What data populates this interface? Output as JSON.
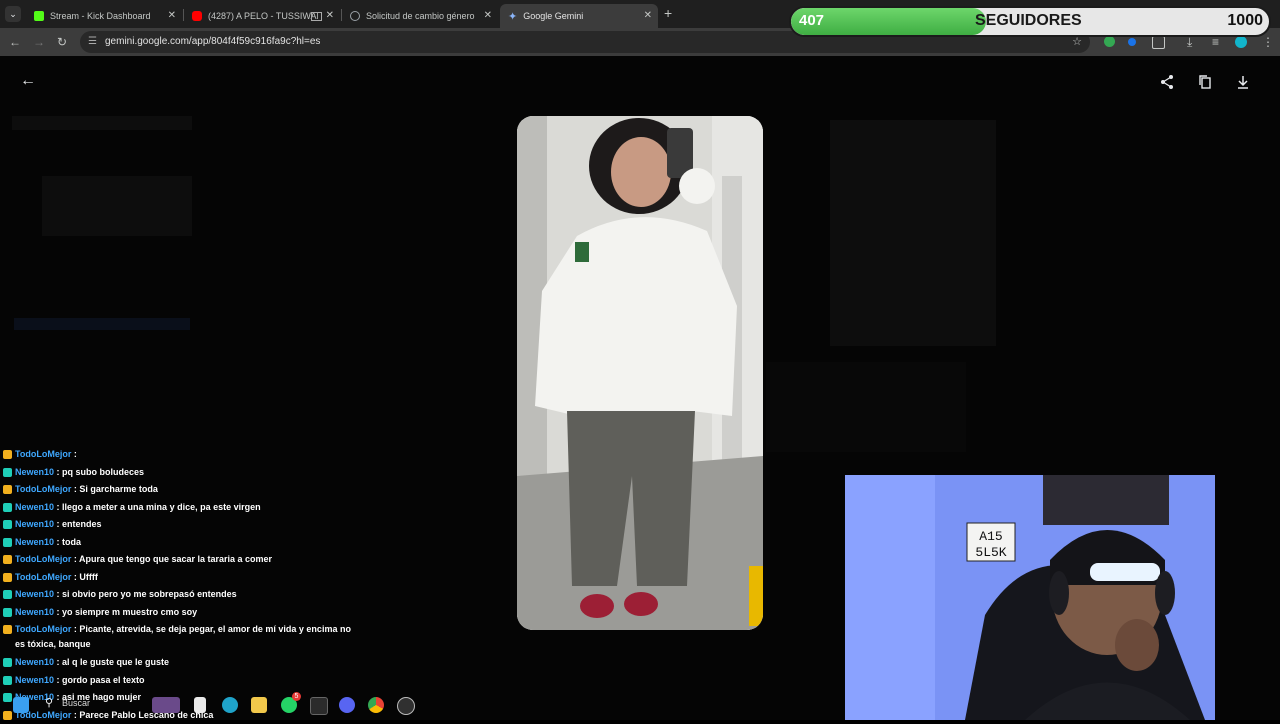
{
  "browser": {
    "tabs": [
      {
        "title": "Stream - Kick Dashboard",
        "icon": "kick-icon",
        "color": "#53fc18"
      },
      {
        "title": "(4287) A PELO - TUSSIWAR...",
        "icon": "youtube-icon",
        "color": "#ff0000"
      },
      {
        "title": "Solicitud de cambio género",
        "icon": "globe-icon",
        "color": "#9aa0a6"
      },
      {
        "title": "Google Gemini",
        "icon": "gemini-icon",
        "color": "#8ab4f8"
      }
    ],
    "active_tab": 3,
    "url": "gemini.google.com/app/804f4f59c916fa9c?hl=es"
  },
  "followers": {
    "current": "407",
    "label": "SEGUIDORES",
    "goal": "1000",
    "progress": 0.407,
    "color": "#4cbf4f"
  },
  "viewer": {
    "back_icon": "arrow-left-icon",
    "actions": [
      "share-icon",
      "copy-icon",
      "download-icon"
    ]
  },
  "chat": [
    {
      "user": "TodoLoMejor",
      "text": " : ",
      "badge": "#f2b01e"
    },
    {
      "user": "Newen10",
      "text": " : pq subo boludeces",
      "badge": "#1fcfb8"
    },
    {
      "user": "TodoLoMejor",
      "text": " : Si garcharme toda",
      "badge": "#f2b01e"
    },
    {
      "user": "Newen10",
      "text": " : llego a meter a una mina y dice, pa este virgen",
      "badge": "#1fcfb8"
    },
    {
      "user": "Newen10",
      "text": " : entendes",
      "badge": "#1fcfb8"
    },
    {
      "user": "Newen10",
      "text": " : toda",
      "badge": "#1fcfb8"
    },
    {
      "user": "TodoLoMejor",
      "text": " : Apura que tengo que sacar la tararia a comer",
      "badge": "#f2b01e"
    },
    {
      "user": "TodoLoMejor",
      "text": " : Uffff",
      "badge": "#f2b01e"
    },
    {
      "user": "Newen10",
      "text": " : si obvio pero yo me sobrepasó entendes",
      "badge": "#1fcfb8"
    },
    {
      "user": "Newen10",
      "text": " : yo siempre m muestro cmo soy",
      "badge": "#1fcfb8"
    },
    {
      "user": "TodoLoMejor",
      "text": " : Picante, atrevida, se deja pegar, el amor de mí vida y encima no es tóxica, banque",
      "badge": "#f2b01e",
      "wrap": true
    },
    {
      "user": "Newen10",
      "text": " : al q le guste que le guste",
      "badge": "#1fcfb8"
    },
    {
      "user": "Newen10",
      "text": " : gordo pasa el texto",
      "badge": "#1fcfb8"
    },
    {
      "user": "Newen10",
      "text": " : asi me hago mujer",
      "badge": "#1fcfb8"
    },
    {
      "user": "TodoLoMejor",
      "text": " : Parece Pablo Lescano de chica",
      "badge": "#f2b01e"
    }
  ],
  "webcam": {
    "sign_line1": "A15",
    "sign_line2": "5L5K"
  },
  "taskbar": {
    "search_label": "Buscar",
    "apps": [
      "windows-start-icon",
      "search-icon",
      "widget-icon",
      "file-icon",
      "edge-icon",
      "folder-icon",
      "whatsapp-icon",
      "epic-icon",
      "discord-icon",
      "chrome-icon",
      "obs-icon"
    ],
    "whatsapp_badge": "5"
  }
}
